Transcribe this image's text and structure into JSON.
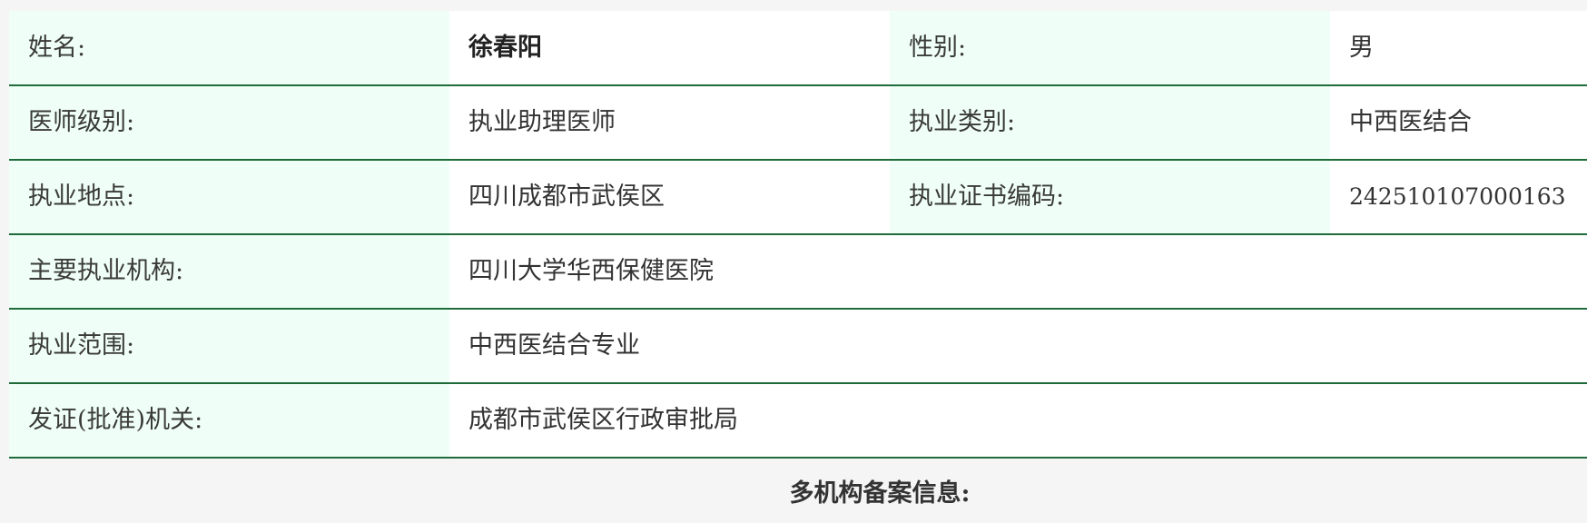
{
  "doctor": {
    "name_label": "姓名:",
    "name_value": "徐春阳",
    "gender_label": "性别:",
    "gender_value": "男",
    "level_label": "医师级别:",
    "level_value": "执业助理医师",
    "category_label": "执业类别:",
    "category_value": "中西医结合",
    "location_label": "执业地点:",
    "location_value": "四川成都市武侯区",
    "cert_label": "执业证书编码:",
    "cert_value": "242510107000163",
    "institution_label": "主要执业机构:",
    "institution_value": "四川大学华西保健医院",
    "scope_label": "执业范围:",
    "scope_value": "中西医结合专业",
    "authority_label": "发证(批准)机关:",
    "authority_value": "成都市武侯区行政审批局"
  },
  "section": {
    "multi_institution_title": "多机构备案信息:"
  },
  "colors": {
    "label_background": "#effff7",
    "border": "#1f6b3a",
    "page_background": "#f5f5f5"
  }
}
